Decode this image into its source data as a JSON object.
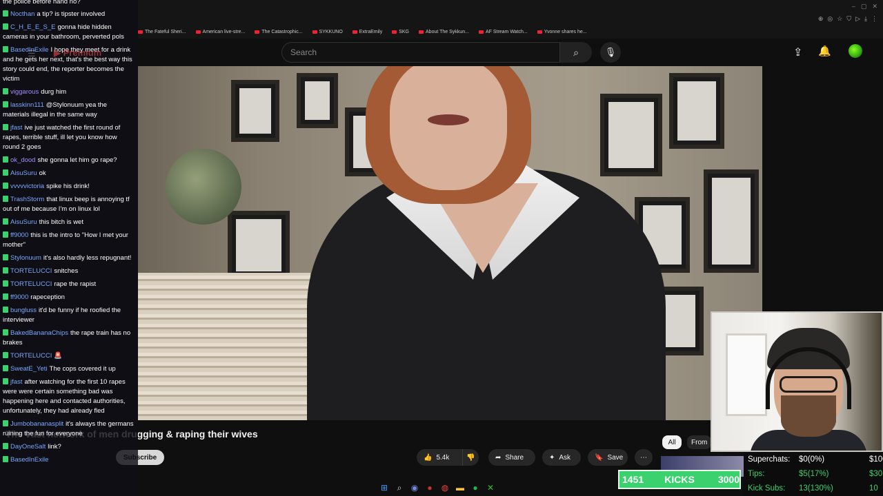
{
  "browser": {
    "bookmarks": [
      {
        "label": "The Fateful Sheri..."
      },
      {
        "label": "American live-stre..."
      },
      {
        "label": "The Catastrophic..."
      },
      {
        "label": "SYKKUNO"
      },
      {
        "label": "ExtraEmily"
      },
      {
        "label": "SKG"
      },
      {
        "label": "About The Sykkun..."
      },
      {
        "label": "AF Stream Watch..."
      },
      {
        "label": "Yvonne shares he..."
      }
    ]
  },
  "youtube": {
    "logo_text": "Premium",
    "search_placeholder": "Search",
    "video_title": "The vast network of men drugging & raping their wives",
    "subscribe_label": "Subscribe",
    "like_count": "5.4k",
    "share_label": "Share",
    "ask_label": "Ask",
    "save_label": "Save",
    "chip_all": "All",
    "chip_from": "From"
  },
  "chat": {
    "top_line": "the police before hand no?",
    "messages": [
      {
        "user": "Nocthan",
        "color": "#7aa8ff",
        "text": "a tip? is tipster involved"
      },
      {
        "user": "C_H_E_E_S_E",
        "color": "#7aa8ff",
        "text": "gonna hide hidden cameras in your bathroom, perverted pols"
      },
      {
        "user": "BasedInExile",
        "color": "#7aa8ff",
        "text": "I hope they meet for a drink and he gets her next, that's the best way this story could end, the reporter becomes the victim"
      },
      {
        "user": "viggarous",
        "color": "#a58cff",
        "text": "durg him"
      },
      {
        "user": "lasskinn111",
        "color": "#7aa8ff",
        "text": "@Stylonuum yea the materials illegal in the same way"
      },
      {
        "user": "jfast",
        "color": "#7aa8ff",
        "text": "ive just watched the first round of rapes, terrible stuff, ill let you know how round 2 goes"
      },
      {
        "user": "ok_dood",
        "color": "#a58cff",
        "text": "she gonna let him go rape?"
      },
      {
        "user": "AisuSuru",
        "color": "#7aa8ff",
        "text": "ok"
      },
      {
        "user": "vvvvvictoria",
        "color": "#7aa8ff",
        "text": "spike his drink!"
      },
      {
        "user": "TrashStorm",
        "color": "#7aa8ff",
        "text": "that linux beep is annoying tf out of me because I'm on linux lol"
      },
      {
        "user": "AisuSuru",
        "color": "#7aa8ff",
        "text": "this bitch is wet"
      },
      {
        "user": "ff9000",
        "color": "#7aa8ff",
        "text": "this is the intro to \"How I met your mother\""
      },
      {
        "user": "Stylonuum",
        "color": "#7aa8ff",
        "text": "it's also hardly less repugnant!"
      },
      {
        "user": "TORTELUCCI",
        "color": "#7aa8ff",
        "text": "snitches"
      },
      {
        "user": "TORTELUCCI",
        "color": "#7aa8ff",
        "text": "rape the rapist"
      },
      {
        "user": "ff9000",
        "color": "#7aa8ff",
        "text": "rapeception"
      },
      {
        "user": "bungluss",
        "color": "#7aa8ff",
        "text": "it'd be funny if he roofied the interviewer"
      },
      {
        "user": "BakedBananaChips",
        "color": "#7aa8ff",
        "text": "the rape train has no brakes"
      },
      {
        "user": "TORTELUCCI",
        "color": "#7aa8ff",
        "text": "🚨"
      },
      {
        "user": "SweatE_Yeti",
        "color": "#7aa8ff",
        "text": "The cops covered it up"
      },
      {
        "user": "jfast",
        "color": "#7aa8ff",
        "text": "after watching for the first 10 rapes were were certain something bad was happening here and contacted authorities, unfortunately, they had already fled"
      },
      {
        "user": "Jumbobananasplit",
        "color": "#7aa8ff",
        "text": "it's always the germans ruining the fun for everyone"
      },
      {
        "user": "DayOneSalt",
        "color": "#7aa8ff",
        "text": "link?"
      },
      {
        "user": "BasedInExile",
        "color": "#7aa8ff",
        "text": ""
      }
    ]
  },
  "stats": {
    "superchats_label": "Superchats:",
    "superchats_value": "$0(0%)",
    "superchats_goal": "$100",
    "tips_label": "Tips:",
    "tips_value": "$5(17%)",
    "tips_goal": "$30",
    "kicksubs_label": "Kick Subs:",
    "kicksubs_value": "13(130%)",
    "kicksubs_goal": "10"
  },
  "kicks": {
    "count": "1451",
    "label": "KICKS",
    "goal": "3000"
  },
  "colors": {
    "accent_green": "#3bd16f",
    "tips_color": "#3bd16f",
    "kicksubs_color": "#3bd16f"
  }
}
